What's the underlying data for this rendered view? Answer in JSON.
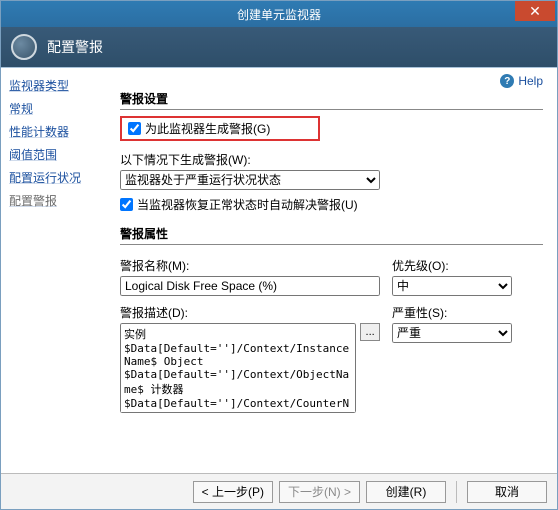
{
  "window": {
    "title": "创建单元监视器"
  },
  "header": {
    "title": "配置警报"
  },
  "help": {
    "label": "Help"
  },
  "sidebar": {
    "items": [
      {
        "label": "监视器类型"
      },
      {
        "label": "常规"
      },
      {
        "label": "性能计数器"
      },
      {
        "label": "阈值范围"
      },
      {
        "label": "配置运行状况"
      },
      {
        "label": "配置警报"
      }
    ]
  },
  "alert_settings": {
    "header": "警报设置",
    "generate_label": "为此监视器生成警报(G)",
    "generate_checked": true,
    "cond_label": "以下情况下生成警报(W):",
    "cond_value": "监视器处于严重运行状况状态",
    "autoresolve_label": "当监视器恢复正常状态时自动解决警报(U)",
    "autoresolve_checked": true
  },
  "alert_props": {
    "header": "警报属性",
    "name_label": "警报名称(M):",
    "name_value": "Logical Disk Free Space (%)",
    "desc_label": "警报描述(D):",
    "desc_value": "实例 $Data[Default='']/Context/InstanceName$ Object $Data[Default='']/Context/ObjectName$ 计数器 $Data[Default='']/Context/CounterName$ 有 $Data[Default='']/Context/Value$ At time $Data[Default='']/Context/TimeSampled$ 值",
    "browse_label": "...",
    "priority_label": "优先级(O):",
    "priority_value": "中",
    "severity_label": "严重性(S):",
    "severity_value": "严重"
  },
  "buttons": {
    "prev": "< 上一步(P)",
    "next": "下一步(N) >",
    "create": "创建(R)",
    "cancel": "取消"
  }
}
